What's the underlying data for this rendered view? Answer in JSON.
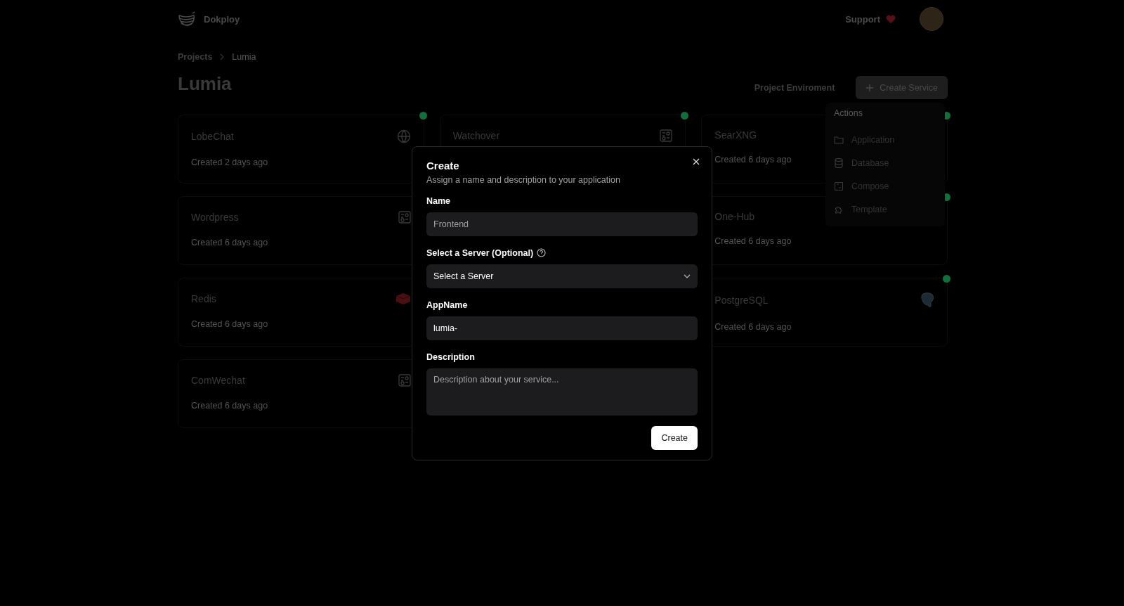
{
  "header": {
    "brand": "Dokploy",
    "support": "Support"
  },
  "breadcrumb": [
    {
      "label": "Projects",
      "current": false
    },
    {
      "label": "Lumia",
      "current": true
    }
  ],
  "title": "Lumia",
  "actions": {
    "environment": "Project Enviroment",
    "create": "Create Service"
  },
  "columns": [
    [
      {
        "name": "LobeChat",
        "created": "Created 2 days ago",
        "kind": "web",
        "running": true
      },
      {
        "name": "Wordpress",
        "created": "Created 6 days ago",
        "kind": "compose",
        "running": false
      },
      {
        "name": "Redis",
        "created": "Created 6 days ago",
        "kind": "redis",
        "running": false
      },
      {
        "name": "ComWechat",
        "created": "Created 6 days ago",
        "kind": "compose",
        "running": false
      }
    ],
    [
      {
        "name": "Watchover",
        "kind": "compose",
        "running": true
      }
    ],
    [
      {
        "name": "SearXNG",
        "created": "Created 6 days ago",
        "kind": "hidden",
        "running": true
      },
      {
        "name": "One-Hub",
        "created": "Created 6 days ago",
        "kind": "hidden",
        "running": true
      },
      {
        "name": "PostgreSQL",
        "created": "Created 6 days ago",
        "kind": "postgres",
        "running": true
      }
    ]
  ],
  "menu": {
    "label": "Actions",
    "items": [
      {
        "label": "Application",
        "kind": "folder"
      },
      {
        "label": "Database",
        "kind": "database"
      },
      {
        "label": "Compose",
        "kind": "compose"
      },
      {
        "label": "Template",
        "kind": "puzzle"
      }
    ]
  },
  "dialog": {
    "title": "Create",
    "subtitle": "Assign a name and description to your application",
    "name": {
      "label": "Name",
      "placeholder": "Frontend"
    },
    "server": {
      "label": "Select a Server (Optional)",
      "value": "Select a Server"
    },
    "app_name": {
      "label": "AppName",
      "value": "lumia-"
    },
    "description": {
      "label": "Description",
      "placeholder": "Description about your service..."
    },
    "submit": "Create"
  }
}
